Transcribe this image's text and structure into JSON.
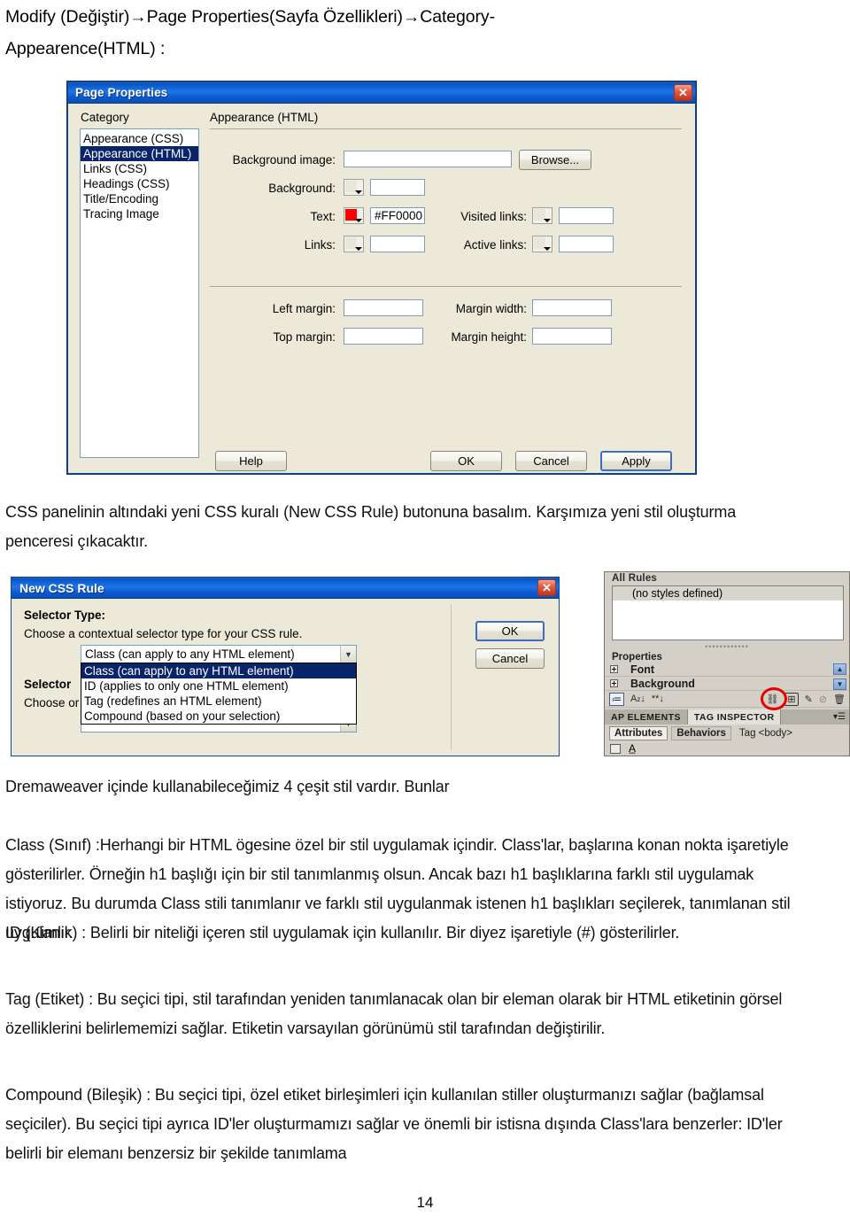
{
  "document": {
    "heading_line1": "Modify (Değiştir)→Page Properties(Sayfa Özellikleri)→Category-",
    "heading_line2": "Appearence(HTML) :",
    "para1": "CSS panelinin altındaki yeni CSS kuralı (New CSS Rule) butonuna basalım. Karşımıza yeni stil oluşturma penceresi çıkacaktır.",
    "para2": "Dremaweaver içinde kullanabileceğimiz 4 çeşit stil vardır. Bunlar",
    "para3": "Class (Sınıf) :Herhangi bir HTML ögesine özel bir stil uygulamak içindir. Class'lar, başlarına konan nokta işaretiyle gösterilirler. Örneğin h1 başlığı için bir stil tanımlanmış olsun. Ancak bazı h1 başlıklarına farklı stil uygulamak istiyoruz. Bu durumda Class stili tanımlanır ve farklı stil uygulanmak istenen h1 başlıkları seçilerek, tanımlanan stil uygulanır.",
    "para4": "ID (Kimlik) : Belirli bir niteliği içeren stil uygulamak için kullanılır. Bir diyez işaretiyle (#) gösterilirler.",
    "para5": "Tag (Etiket) : Bu seçici tipi, stil tarafından yeniden tanımlanacak olan bir eleman olarak bir HTML etiketinin görsel özelliklerini belirlememizi sağlar. Etiketin varsayılan görünümü stil tarafından değiştirilir.",
    "para6": "Compound (Bileşik) : Bu seçici tipi, özel etiket birleşimleri için kullanılan stiller oluşturmanızı sağlar (bağlamsal seçiciler). Bu seçici tipi ayrıca ID'ler oluşturmamızı sağlar ve önemli bir istisna dışında Class'lara benzerler: ID'ler belirli bir elemanı benzersiz bir şekilde tanımlama",
    "page_number": "14"
  },
  "page_properties_dialog": {
    "title": "Page Properties",
    "close_label": "✕",
    "category_label": "Category",
    "categories": [
      "Appearance (CSS)",
      "Appearance (HTML)",
      "Links (CSS)",
      "Headings (CSS)",
      "Title/Encoding",
      "Tracing Image"
    ],
    "selected_category": "Appearance (HTML)",
    "pane_title": "Appearance (HTML)",
    "fields": {
      "background_image_label": "Background image:",
      "background_image_value": "",
      "browse_label": "Browse...",
      "background_label": "Background:",
      "background_value": "",
      "text_label": "Text:",
      "text_value": "#FF0000",
      "text_color": "#FF0000",
      "links_label": "Links:",
      "links_value": "",
      "visited_links_label": "Visited links:",
      "visited_links_value": "",
      "active_links_label": "Active links:",
      "active_links_value": "",
      "left_margin_label": "Left margin:",
      "left_margin_value": "",
      "top_margin_label": "Top margin:",
      "top_margin_value": "",
      "margin_width_label": "Margin width:",
      "margin_width_value": "",
      "margin_height_label": "Margin height:",
      "margin_height_value": ""
    },
    "buttons": {
      "help": "Help",
      "ok": "OK",
      "cancel": "Cancel",
      "apply": "Apply"
    }
  },
  "new_css_rule_dialog": {
    "title": "New CSS Rule",
    "close_label": "✕",
    "selector_type_label": "Selector Type:",
    "selector_type_desc": "Choose a contextual selector type for your CSS rule.",
    "selector_type_value": "Class (can apply to any HTML element)",
    "selector_type_options": [
      "Class (can apply to any HTML element)",
      "ID (applies to only one HTML element)",
      "Tag (redefines an HTML element)",
      "Compound (based on your selection)"
    ],
    "selector_name_label": "Selector",
    "selector_name_desc": "Choose or",
    "selector_name_value": "",
    "buttons": {
      "ok": "OK",
      "cancel": "Cancel"
    }
  },
  "css_panel": {
    "all_rules_header": "All Rules",
    "no_styles_text": "(no styles defined)",
    "properties_header": "Properties",
    "property_rows": [
      "Font",
      "Background"
    ],
    "toolbar": {
      "show_category_view": "category-view-icon",
      "show_list_view": "alphabet-sort-icon",
      "show_set_properties": "set-properties-icon",
      "attach_style_sheet": "link-icon",
      "new_css_rule": "new-css-rule-icon",
      "edit_rule": "pencil-icon",
      "disable": "disable-icon",
      "delete": "trash-icon",
      "sort_az_label": "A",
      "sort_z_label": "z",
      "star_label": "**"
    },
    "scroll_up": "▲",
    "scroll_down": "▼",
    "tabs": [
      "AP ELEMENTS",
      "TAG INSPECTOR"
    ],
    "active_tab": "TAG INSPECTOR",
    "tab_menu_icon": "panel-menu-icon",
    "subtabs": [
      "Attributes",
      "Behaviors"
    ],
    "tag_label": "Tag <body>"
  }
}
